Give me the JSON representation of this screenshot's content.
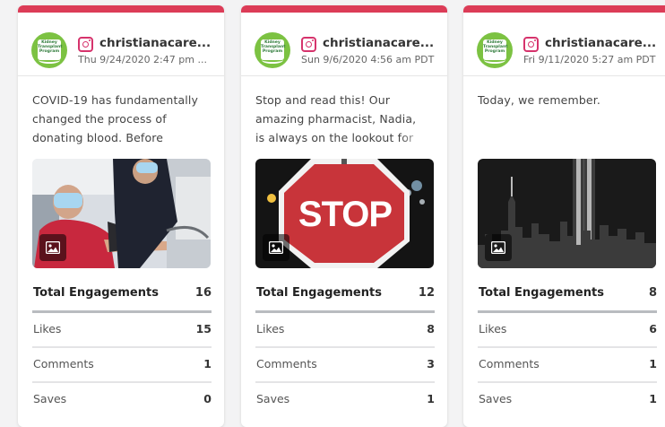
{
  "colors": {
    "accent_bar": "#dc3c57",
    "instagram": "#d6336c",
    "avatar_green": "#7cc242"
  },
  "avatar_text": "Kidney Transplant Program",
  "posts": [
    {
      "account": "christianacare...",
      "date": "Thu 9/24/2020 2:47 pm ...",
      "caption": "COVID-19 has fundamentally changed the process of donating blood. Before COVID",
      "media_alt": "blood donation photo",
      "stats": [
        {
          "label": "Total Engagements",
          "value": "16"
        },
        {
          "label": "Likes",
          "value": "15"
        },
        {
          "label": "Comments",
          "value": "1"
        },
        {
          "label": "Saves",
          "value": "0"
        }
      ]
    },
    {
      "account": "christianacare...",
      "date": "Sun 9/6/2020 4:56 am PDT",
      "caption": "Stop and read this! Our amazing pharmacist, Nadia, is always on the lookout for you",
      "media_alt": "STOP",
      "stats": [
        {
          "label": "Total Engagements",
          "value": "12"
        },
        {
          "label": "Likes",
          "value": "8"
        },
        {
          "label": "Comments",
          "value": "3"
        },
        {
          "label": "Saves",
          "value": "1"
        }
      ]
    },
    {
      "account": "christianacare...",
      "date": "Fri 9/11/2020 5:27 am PDT",
      "caption": "Today, we remember.",
      "media_alt": "tribute in light skyline",
      "stats": [
        {
          "label": "Total Engagements",
          "value": "8"
        },
        {
          "label": "Likes",
          "value": "6"
        },
        {
          "label": "Comments",
          "value": "1"
        },
        {
          "label": "Saves",
          "value": "1"
        }
      ]
    }
  ]
}
